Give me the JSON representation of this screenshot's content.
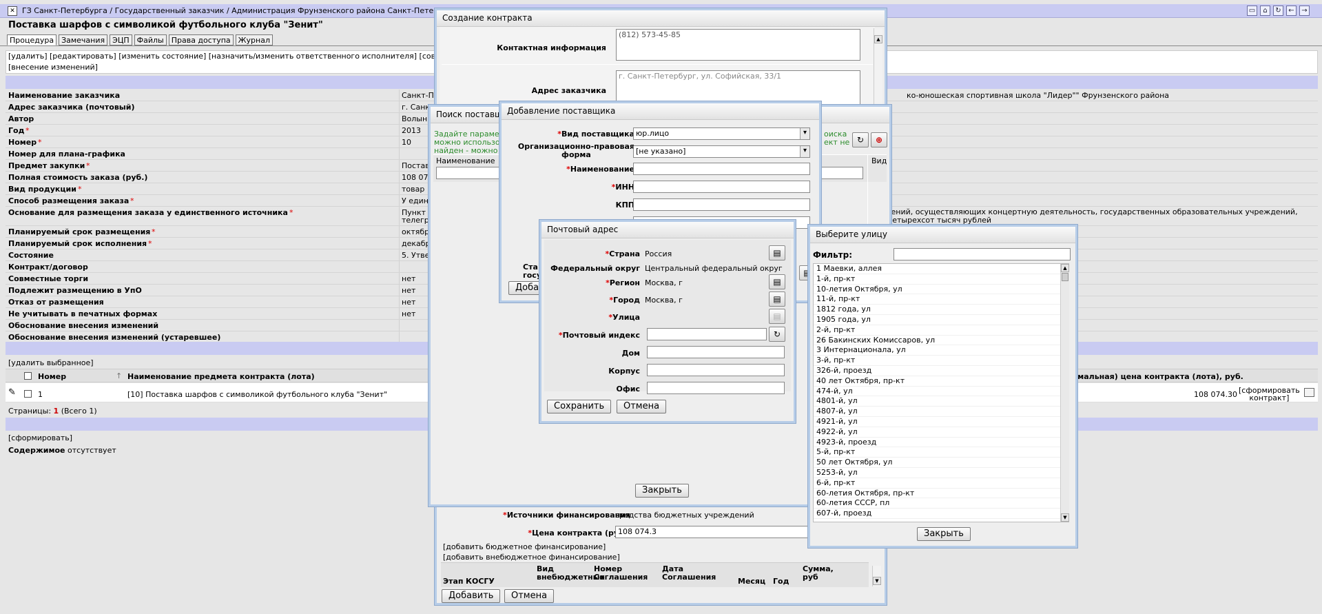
{
  "topbar": {
    "breadcrumb": "ГЗ Санкт-Петербурга / Государственный заказчик / Администрация Фрунзенского района Санкт-Петербурга",
    "icons": [
      "folder-icon",
      "home-icon",
      "refresh-icon",
      "back-icon",
      "forward-icon"
    ]
  },
  "page": {
    "title": "Поставка шарфов с символикой футбольного клуба \"Зенит\"",
    "tabs": [
      "Процедура",
      "Замечания",
      "ЭЦП",
      "Файлы",
      "Права доступа",
      "Журнал"
    ],
    "actions_line1": "[удалить] [редактировать] [изменить состояние] [назначить/изменить ответственного исполнителя] [совместные торги]",
    "actions_line2": "[внесение изменений]",
    "props": [
      {
        "label": "Наименование заказчика",
        "req": false,
        "value": "Санкт-Петербургское государственное бюджетное образовательное учреждение"
      },
      {
        "label": "Адрес заказчика (почтовый)",
        "req": false,
        "value": "г. Санкт-Петербург, ул. Софийская, 33/1"
      },
      {
        "label": "Автор",
        "req": false,
        "value": "Волынкина"
      },
      {
        "label": "Год",
        "req": true,
        "value": "2013"
      },
      {
        "label": "Номер",
        "req": true,
        "value": "10"
      },
      {
        "label": "Номер для плана-графика",
        "req": false,
        "value": ""
      },
      {
        "label": "Предмет закупки",
        "req": true,
        "value": "Поставка шарфов"
      },
      {
        "label": "Полная стоимость заказа (руб.)",
        "req": false,
        "value": "108 074.30"
      },
      {
        "label": "Вид продукции",
        "req": true,
        "value": "товар"
      },
      {
        "label": "Способ размещения заказа",
        "req": true,
        "value": "У единственного поставщика"
      },
      {
        "label": "Основание для размещения заказа у единственного источника",
        "req": true,
        "value": "Пункт",
        "value2": "телеграфа",
        "tall": true
      },
      {
        "label": "Планируемый срок размещения",
        "req": true,
        "value": "октябрь"
      },
      {
        "label": "Планируемый срок исполнения",
        "req": true,
        "value": "декабрь"
      },
      {
        "label": "Состояние",
        "req": false,
        "value": "5. Утвержден"
      },
      {
        "label": "Контракт/договор",
        "req": false,
        "value": ""
      },
      {
        "label": "Совместные торги",
        "req": false,
        "value": "нет"
      },
      {
        "label": "Подлежит размещению в УпО",
        "req": false,
        "value": "нет"
      },
      {
        "label": "Отказ от размещения",
        "req": false,
        "value": "нет"
      },
      {
        "label": "Не учитывать в печатных формах",
        "req": false,
        "value": "нет"
      },
      {
        "label": "Обоснование внесения изменений",
        "req": false,
        "value": ""
      },
      {
        "label": "Обоснование внесения изменений (устаревшее)",
        "req": false,
        "value": ""
      }
    ],
    "right_customer": "ко-юношеская спортивная школа \"Лидер\"\" Фрунзенского района",
    "right_basis1": "ждений, осуществляющих концертную деятельность, государственных образовательных учреждений,",
    "right_basis2": "ю четыреxсот тысяч рублей",
    "delete_selected": "[удалить выбранное]",
    "lots_headers": {
      "number": "Номер",
      "name": "Наименование предмета контракта (лота)",
      "price": "симальная) цена контракта (лота), руб."
    },
    "lot": {
      "number": "1",
      "name": "[10] Поставка шарфов с символикой футбольного клуба \"Зенит\"",
      "price": "108 074.30",
      "action1": "[сформировать",
      "action2": "контракт]"
    },
    "pages_label": "Страницы:",
    "pages_current": "1",
    "pages_total": "(Всего 1)",
    "form_link": "[сформировать]",
    "content_label": "Содержимое",
    "content_value": "отсутствует"
  },
  "contract_dialog": {
    "title": "Создание контракта",
    "contact_label": "Контактная информация",
    "contact_value": "(812) 573-45-85",
    "address_label": "Адрес заказчика",
    "address_value": "г. Санкт-Петербург, ул. Софийская, 33/1",
    "funding_label": "Источники финансирования",
    "funding_value": "средства бюджетных учреждений",
    "price_label": "Цена контракта (руб.)",
    "price_value": "108 074.3",
    "add_budget": "[добавить бюджетное финансирование]",
    "add_offbudget": "[добавить внебюджетное финансирование]",
    "cols": [
      "Этап",
      "КОСГУ",
      "Вид внебюджетных",
      "Номер Соглашения",
      "Дата Соглашения",
      "Месяц",
      "Год",
      "Сумма, руб"
    ],
    "add_btn": "Добавить",
    "cancel_btn": "Отмена"
  },
  "search_dialog": {
    "title": "Поиск поставщика",
    "hint1": "Задайте параметры поиска",
    "hint2": "можно использовать",
    "hint3": "найден - можно",
    "hint_right1": "оиска",
    "hint_right2": "ект не",
    "col_name": "Наименование",
    "col_kind": "Вид",
    "close_btn": "Закрыть"
  },
  "supplier_dialog": {
    "title": "Добавление поставщика",
    "kind_label": "Вид поставщика",
    "kind_value": "юр.лицо",
    "form_label1": "Организационно-правовая",
    "form_label2": "форма",
    "form_value": "[не указано]",
    "name_label": "Наименование",
    "inn_label": "ИНН",
    "kpp_label": "КПП",
    "status_label1": "Ста",
    "status_label2": "государ",
    "add_btn": "Добав"
  },
  "postal_dialog": {
    "title": "Почтовый адрес",
    "country_label": "Страна",
    "country_value": "Россия",
    "district_label": "Федеральный округ",
    "district_value": "Центральный федеральный округ",
    "region_label": "Регион",
    "region_value": "Москва, г",
    "city_label": "Город",
    "city_value": "Москва, г",
    "street_label": "Улица",
    "zip_label": "Почтовый индекс",
    "house_label": "Дом",
    "building_label": "Корпус",
    "office_label": "Офис",
    "save_btn": "Сохранить",
    "cancel_btn": "Отмена"
  },
  "street_dialog": {
    "title": "Выберите улицу",
    "filter_label": "Фильтр:",
    "streets": [
      "1 Маевки, аллея",
      "1-й, пр-кт",
      "10-летия Октября, ул",
      "11-й, пр-кт",
      "1812 года, ул",
      "1905 года, ул",
      "2-й, пр-кт",
      "26 Бакинских Комиссаров, ул",
      "3 Интернационала, ул",
      "3-й, пр-кт",
      "326-й, проезд",
      "40 лет Октября, пр-кт",
      "474-й, ул",
      "4801-й, ул",
      "4807-й, ул",
      "4921-й, ул",
      "4922-й, ул",
      "4923-й, проезд",
      "5-й, пр-кт",
      "50 лет Октября, ул",
      "5253-й, ул",
      "6-й, пр-кт",
      "60-летия Октября, пр-кт",
      "60-летия СССР, пл",
      "607-й, проезд"
    ],
    "close_btn": "Закрыть"
  }
}
